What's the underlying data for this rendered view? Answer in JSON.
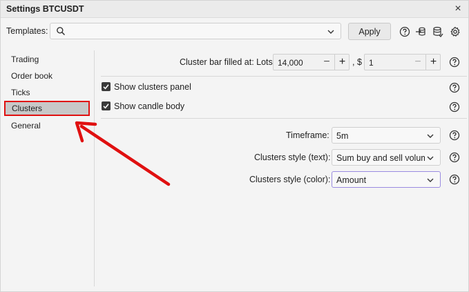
{
  "window": {
    "title": "Settings BTCUSDT",
    "close_symbol": "×"
  },
  "templates": {
    "label": "Templates:",
    "value": "",
    "apply_label": "Apply"
  },
  "sidebar": {
    "items": [
      {
        "label": "Trading"
      },
      {
        "label": "Order book"
      },
      {
        "label": "Ticks"
      },
      {
        "label": "Clusters"
      },
      {
        "label": "General"
      }
    ],
    "selected": "Clusters"
  },
  "clusters": {
    "bar_filled_label": "Cluster bar filled at: Lots",
    "lots_value": "14,000",
    "dollar_sep": ", $",
    "dollar_value": "1",
    "minus_symbol": "−",
    "plus_symbol": "+",
    "show_clusters_panel": {
      "label": "Show clusters panel",
      "checked": true
    },
    "show_candle_body": {
      "label": "Show candle body",
      "checked": true
    },
    "timeframe": {
      "label": "Timeframe:",
      "value": "5m"
    },
    "style_text": {
      "label": "Clusters style (text):",
      "value": "Sum buy and sell volume"
    },
    "style_color": {
      "label": "Clusters style (color):",
      "value": "Amount"
    }
  },
  "colors": {
    "highlight": "#e01010",
    "focus": "#9a8be0"
  }
}
